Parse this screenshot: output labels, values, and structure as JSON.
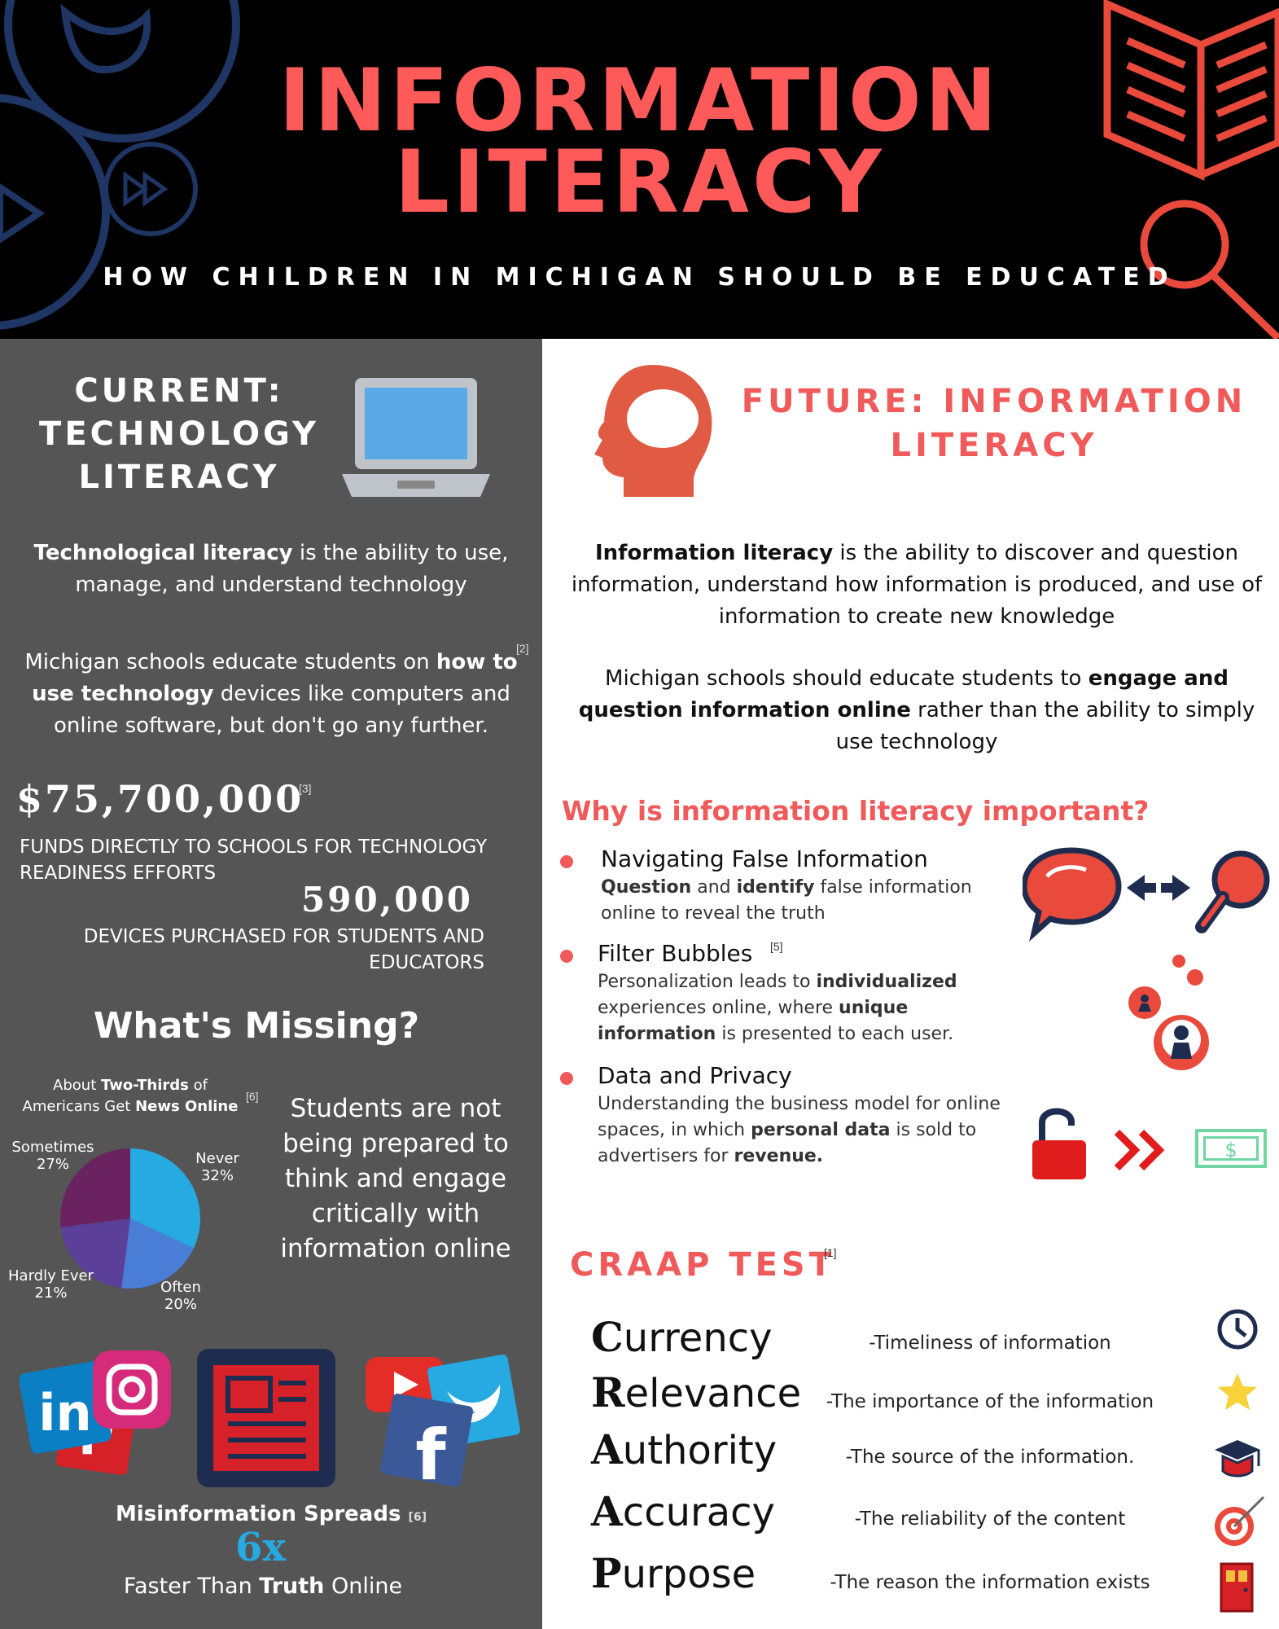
{
  "header": {
    "title_line1": "INFORMATION",
    "title_line2": "LITERACY",
    "subtitle": "HOW CHILDREN IN MICHIGAN SHOULD BE EDUCATED"
  },
  "current": {
    "heading_line1": "CURRENT:",
    "heading_line2": "TECHNOLOGY",
    "heading_line3": "LITERACY",
    "def_bold": "Technological literacy",
    "def_rest": " is the ability to use, manage, and understand technology",
    "schools_p1": "Michigan schools educate students on ",
    "schools_bold": "how to use technology",
    "schools_p2": " devices like computers and online software, but don't go any further.",
    "ref_schools": "[2]",
    "funds_value": "$75,700,000",
    "ref_funds": "[3]",
    "funds_label": "FUNDS DIRECTLY TO SCHOOLS FOR TECHNOLOGY READINESS EFFORTS",
    "devices_value": "590,000",
    "devices_label": "DEVICES PURCHASED FOR STUDENTS AND EDUCATORS"
  },
  "missing": {
    "heading": "What's Missing?",
    "pie_title_a": "About ",
    "pie_title_b": "Two-Thirds",
    "pie_title_c": " of",
    "pie_title_d": "Americans Get ",
    "pie_title_e": "News Online",
    "ref_pie": "[6]",
    "students_text": "Students are not being prepared to think and engage critically with information online",
    "misinfo_a": "Misinformation Spreads",
    "ref_misinfo": "[6]",
    "multiplier": "6x",
    "faster_a": "Faster Than ",
    "faster_b": "Truth",
    "faster_c": " Online"
  },
  "chart_data": {
    "type": "pie",
    "title": "About Two-Thirds of Americans Get News Online",
    "series": [
      {
        "label": "Never",
        "value": 32,
        "display": "32%",
        "color": "#27a9e1"
      },
      {
        "label": "Often",
        "value": 20,
        "display": "20%",
        "color": "#4a7ed6"
      },
      {
        "label": "Hardly Ever",
        "value": 21,
        "display": "21%",
        "color": "#5b3f99"
      },
      {
        "label": "Sometimes",
        "value": 27,
        "display": "27%",
        "color": "#6a2261"
      }
    ]
  },
  "future": {
    "heading_line1": "FUTURE: INFORMATION",
    "heading_line2": "LITERACY",
    "def_bold": "Information literacy",
    "def_rest": " is the ability to discover and question information, understand how information is produced, and use of information to create new knowledge",
    "schools_p1": "Michigan schools should educate students to ",
    "schools_bold": "engage and question information online",
    "schools_p2": " rather than the ability to  simply use technology",
    "why_heading": "Why is information literacy important?",
    "b1_title": "Navigating False Information",
    "b1_t1": "Question",
    "b1_t2": " and ",
    "b1_t3": "identify",
    "b1_t4": " false information online to reveal the truth",
    "b2_title": "Filter Bubbles",
    "ref_b2": "[5]",
    "b2_t1": "Personalization leads to ",
    "b2_t2": "individualized",
    "b2_t3": " experiences online, where ",
    "b2_t4": "unique information",
    "b2_t5": " is presented to each user.",
    "b3_title": "Data and Privacy",
    "b3_t1": "Understanding the business model for online spaces, in which ",
    "b3_t2": "personal data",
    "b3_t3": " is sold to advertisers for ",
    "b3_t4": "revenue.",
    "dollar": "$",
    "craap_heading": "CRAAP TEST",
    "ref_craap": "[1]",
    "craap": [
      {
        "letter": "C",
        "rest": "urrency",
        "desc": "-Timeliness of information"
      },
      {
        "letter": "R",
        "rest": "elevance",
        "desc": "-The importance of the information"
      },
      {
        "letter": "A",
        "rest": "uthority",
        "desc": "-The source of the information."
      },
      {
        "letter": "A",
        "rest": "ccuracy",
        "desc": "-The reliability of the content"
      },
      {
        "letter": "P",
        "rest": "urpose",
        "desc": "-The reason the information exists"
      }
    ]
  },
  "icons": {
    "twitter": "twitter-icon",
    "play": "play-icon",
    "fast_forward": "fast-forward-icon",
    "book": "open-book-icon",
    "magnifier": "magnifier-icon",
    "laptop": "laptop-icon",
    "head": "head-icon",
    "speech": "speech-bubble-icon",
    "people": "people-bubbles-icon",
    "lock": "unlocked-padlock-icon",
    "money": "money-bill-icon",
    "clock": "clock-icon",
    "star": "star-icon",
    "grad": "graduation-cap-icon",
    "target": "target-icon",
    "door": "door-icon",
    "social": [
      "linkedin-icon",
      "instagram-icon",
      "pinterest-icon",
      "newspaper-icon",
      "youtube-icon",
      "twitter-icon",
      "facebook-icon"
    ]
  },
  "colors": {
    "accent": "#f05a5a",
    "navy": "#1e2d4f",
    "left_bg": "#555555",
    "blue": "#27a9e1"
  }
}
